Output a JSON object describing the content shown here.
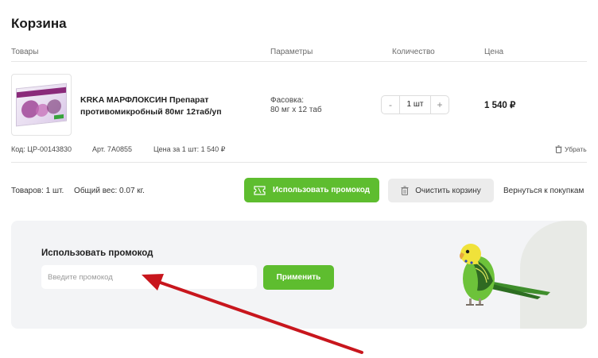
{
  "page": {
    "title": "Корзина"
  },
  "table_headers": {
    "products": "Товары",
    "params": "Параметры",
    "qty": "Количество",
    "price": "Цена"
  },
  "item": {
    "name": "KRKA МАРФЛОКСИН Препарат противомикробный 80мг 12таб/уп",
    "param_label": "Фасовка:",
    "param_value": "80 мг х 12 таб",
    "qty_minus": "-",
    "qty_value": "1 шт",
    "qty_plus": "+",
    "price": "1 540 ₽",
    "code": "Код: ЦР-00143830",
    "article": "Арт. 7А0855",
    "unit_price": "Цена за 1 шт: 1 540 ₽",
    "remove_label": "Убрать"
  },
  "summary": {
    "count": "Товаров: 1 шт.",
    "weight": "Общий вес: 0.07 кг."
  },
  "actions": {
    "use_promo": "Использовать промокод",
    "clear_cart": "Очистить корзину",
    "back": "Вернуться к покупкам"
  },
  "promo": {
    "title": "Использовать промокод",
    "placeholder": "Введите промокод",
    "apply": "Применить"
  },
  "colors": {
    "accent_green": "#5ebd2f",
    "arrow_red": "#c8161d"
  },
  "icons": {
    "coupon": "coupon-icon",
    "trash": "trash-icon",
    "remove": "trash-small-icon"
  }
}
